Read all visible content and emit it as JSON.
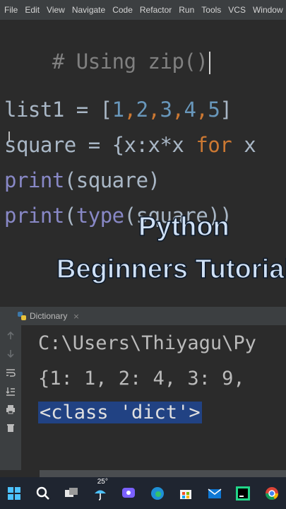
{
  "menubar": {
    "items": [
      "File",
      "Edit",
      "View",
      "Navigate",
      "Code",
      "Refactor",
      "Run",
      "Tools",
      "VCS",
      "Window"
    ]
  },
  "editor": {
    "line1": "# Using zip()",
    "line2_name": "list1 = [",
    "line2_nums": [
      "1",
      "2",
      "3",
      "4",
      "5"
    ],
    "line3_a": "square = {x:x*x ",
    "line3_kw": "for",
    "line3_b": " x",
    "line4_fn": "print",
    "line4_rest": "(square)",
    "line5_fn": "print",
    "line5_open": "(",
    "line5_type": "type",
    "line5_rest": "(square))"
  },
  "overlay": {
    "line1": "Python",
    "line2": "Beginners Tutorial"
  },
  "run_panel": {
    "tab_label": "Dictionary",
    "close": "×",
    "output": [
      "C:\\Users\\Thiyagu\\Py",
      "{1: 1, 2: 4, 3: 9, ",
      "<class 'dict'>"
    ]
  },
  "taskbar": {
    "weather_temp": "25°",
    "icons": [
      "windows-start-icon",
      "search-icon",
      "task-view-icon",
      "weather-icon",
      "chat-icon",
      "edge-icon",
      "store-icon",
      "mail-icon",
      "pycharm-icon",
      "chrome-icon"
    ]
  },
  "colors": {
    "editor_bg": "#2b2b2b",
    "comment": "#808080",
    "number": "#6897bb",
    "keyword": "#cc7832",
    "builtin": "#8888c6",
    "selection": "#214283"
  }
}
